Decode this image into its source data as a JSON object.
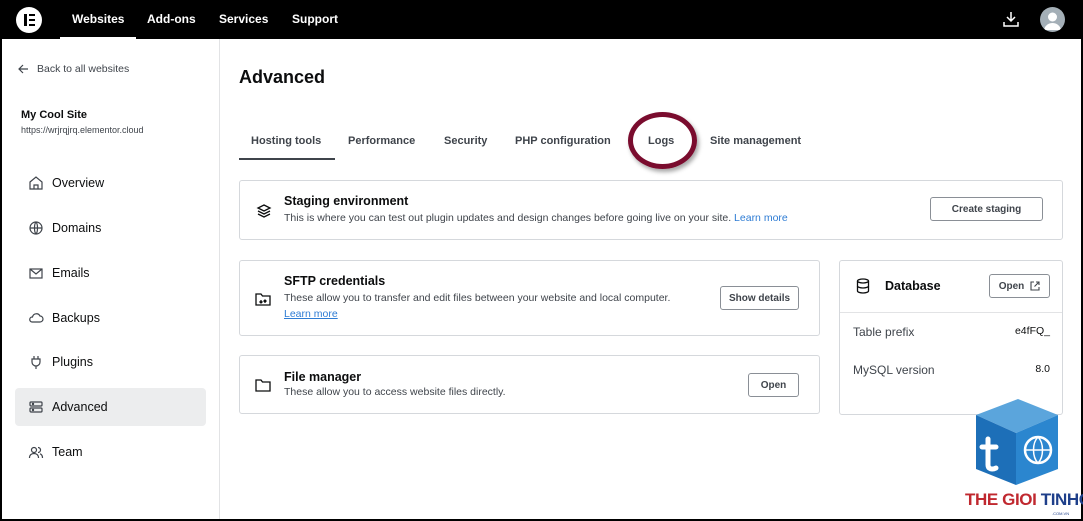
{
  "topbar": {
    "nav": [
      "Websites",
      "Add-ons",
      "Services",
      "Support"
    ]
  },
  "sidebar": {
    "back_label": "Back to all websites",
    "site_name": "My Cool Site",
    "site_url": "https://wrjrqjrq.elementor.cloud",
    "items": [
      {
        "label": "Overview",
        "icon": "home-icon"
      },
      {
        "label": "Domains",
        "icon": "globe-icon"
      },
      {
        "label": "Emails",
        "icon": "mail-icon"
      },
      {
        "label": "Backups",
        "icon": "cloud-icon"
      },
      {
        "label": "Plugins",
        "icon": "plug-icon"
      },
      {
        "label": "Advanced",
        "icon": "server-icon",
        "active": true
      },
      {
        "label": "Team",
        "icon": "team-icon"
      }
    ]
  },
  "main": {
    "title": "Advanced",
    "tabs": [
      "Hosting tools",
      "Performance",
      "Security",
      "PHP configuration",
      "Logs",
      "Site management"
    ],
    "active_tab": "Hosting tools",
    "staging": {
      "title": "Staging environment",
      "desc": "This is where you can test out plugin updates and design changes before going live on your site.",
      "link": "Learn more",
      "button": "Create staging"
    },
    "sftp": {
      "title": "SFTP credentials",
      "desc": "These allow you to transfer and edit files between your website and local computer.",
      "link": "Learn more",
      "button": "Show details"
    },
    "file_manager": {
      "title": "File manager",
      "desc": "These allow you to access website files directly.",
      "button": "Open"
    },
    "database": {
      "title": "Database",
      "button": "Open",
      "rows": [
        {
          "label": "Table prefix",
          "value": "e4fFQ_"
        },
        {
          "label": "MySQL version",
          "value": "8.0"
        }
      ]
    }
  },
  "watermark": {
    "brand_red": "THE GIOI ",
    "brand_blue": "TINHOC",
    "sub": ".COM.VN"
  },
  "colors": {
    "accent_link": "#2e7cd4",
    "highlight_ring": "#7a0c2e",
    "topbar": "#000000"
  }
}
